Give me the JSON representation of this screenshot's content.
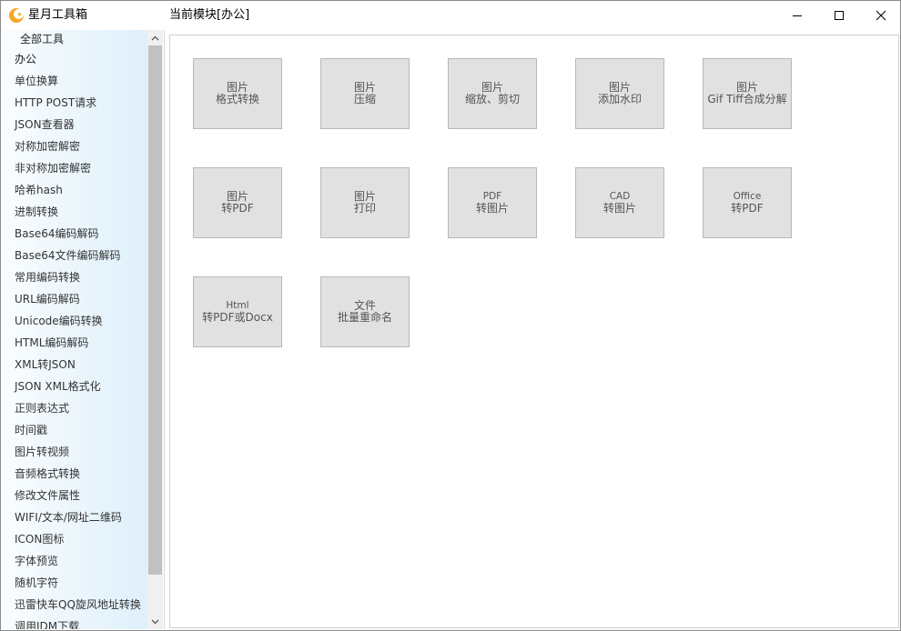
{
  "app": {
    "title": "星月工具箱",
    "module_title": "当前模块[办公]"
  },
  "window_buttons": {
    "minimize_icon": "minimize-icon",
    "maximize_icon": "maximize-icon",
    "close_icon": "close-icon"
  },
  "sidebar": {
    "header": "全部工具",
    "items": [
      "办公",
      "单位换算",
      "HTTP POST请求",
      "JSON查看器",
      "对称加密解密",
      "非对称加密解密",
      "哈希hash",
      "进制转换",
      "Base64编码解码",
      "Base64文件编码解码",
      "常用编码转换",
      "URL编码解码",
      "Unicode编码转换",
      "HTML编码解码",
      "XML转JSON",
      "JSON XML格式化",
      "正则表达式",
      "时间戳",
      "图片转视频",
      "音频格式转换",
      "修改文件属性",
      "WIFI/文本/网址二维码",
      "ICON图标",
      "字体预览",
      "随机字符",
      "迅雷快车QQ旋风地址转换",
      "调用IDM下载"
    ]
  },
  "tiles": [
    {
      "line1": "图片",
      "line2": "格式转换"
    },
    {
      "line1": "图片",
      "line2": "压缩"
    },
    {
      "line1": "图片",
      "line2": "缩放、剪切"
    },
    {
      "line1": "图片",
      "line2": "添加水印"
    },
    {
      "line1": "图片",
      "line2": "Gif Tiff合成分解"
    },
    {
      "line1": "图片",
      "line2": "转PDF"
    },
    {
      "line1": "图片",
      "line2": "打印"
    },
    {
      "line1": "PDF",
      "line2": "转图片"
    },
    {
      "line1": "CAD",
      "line2": "转图片"
    },
    {
      "line1": "Office",
      "line2": "转PDF"
    },
    {
      "line1": "Html",
      "line2": "转PDF或Docx"
    },
    {
      "line1": "文件",
      "line2": "批量重命名"
    }
  ],
  "colors": {
    "logo": "#f5a623",
    "tile_bg": "#e1e1e1",
    "tile_border": "#b8b8b8",
    "sidebar_tint": "#def0fb"
  }
}
